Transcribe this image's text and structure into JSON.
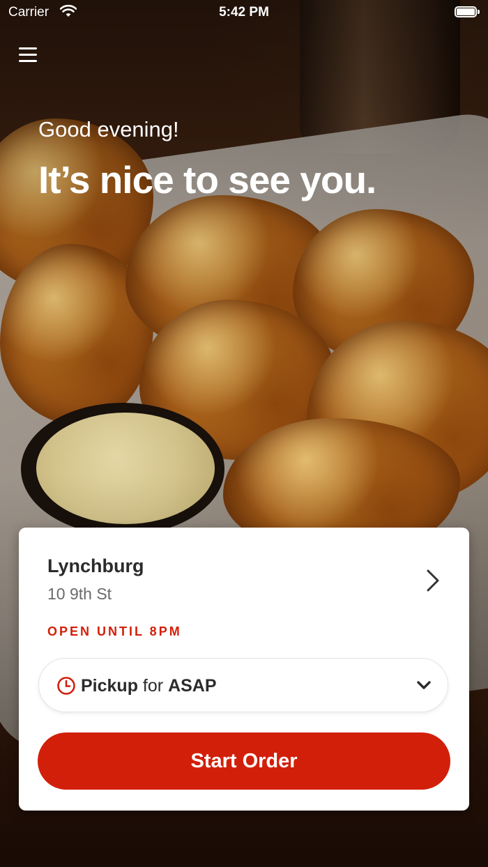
{
  "status_bar": {
    "carrier": "Carrier",
    "time": "5:42 PM"
  },
  "header": {
    "greeting": "Good evening!",
    "headline": "It’s nice to see you."
  },
  "location_card": {
    "store_name": "Lynchburg",
    "address": "10 9th St",
    "hours": "OPEN UNTIL 8PM",
    "pickup": {
      "mode": "Pickup",
      "connector": " for ",
      "time": "ASAP"
    },
    "start_button_label": "Start Order"
  },
  "colors": {
    "accent": "#d21f0a",
    "text_dark": "#2b2b2b",
    "text_muted": "#6a6a6a"
  },
  "icons": [
    "menu-icon",
    "wifi-icon",
    "battery-icon",
    "chevron-right-icon",
    "clock-icon",
    "chevron-down-icon"
  ]
}
